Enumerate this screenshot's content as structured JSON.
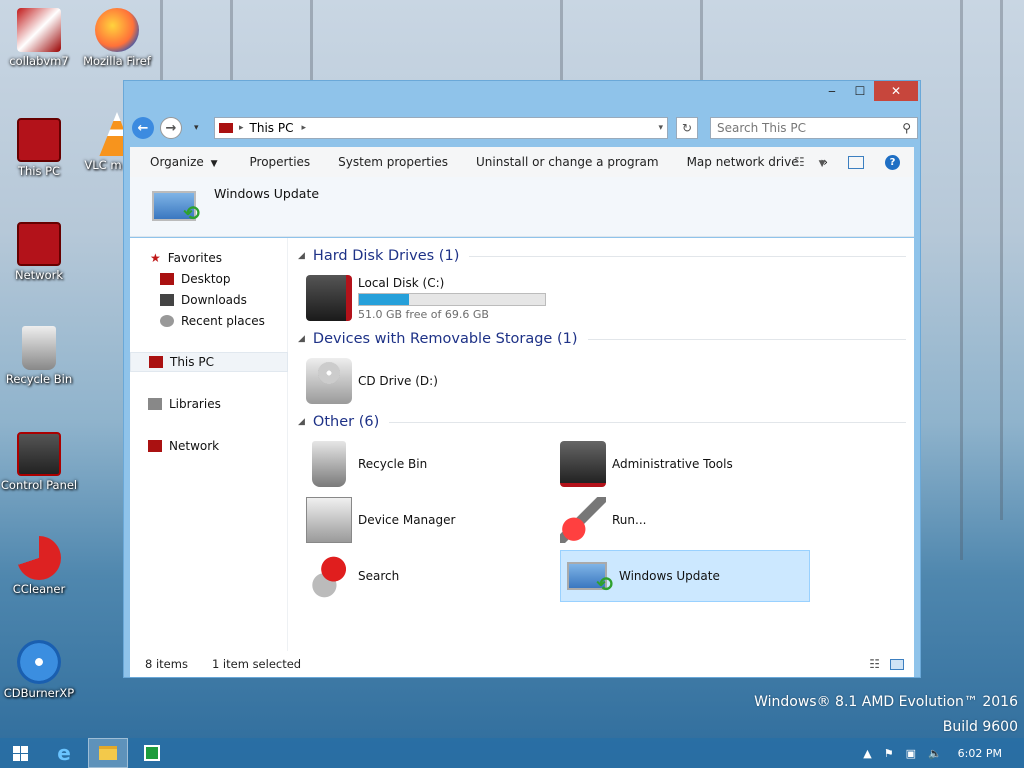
{
  "desktop": {
    "icons": [
      {
        "label": "collabvm7"
      },
      {
        "label": "Mozilla Firef"
      },
      {
        "label": "This PC"
      },
      {
        "label": "VLC m play"
      },
      {
        "label": "Network"
      },
      {
        "label": "Recycle Bin"
      },
      {
        "label": "Control Panel"
      },
      {
        "label": "CCleaner"
      },
      {
        "label": "CDBurnerXP"
      }
    ],
    "watermark_line1": "Windows® 8.1 AMD Evolution™ 2016",
    "watermark_line2": "Build 9600"
  },
  "window": {
    "controls": {
      "minimize": "‒",
      "maximize": "☐",
      "close": "✕"
    },
    "address": {
      "location": "This PC"
    },
    "search": {
      "placeholder": "Search This PC"
    },
    "toolbar": {
      "organize": "Organize",
      "properties": "Properties",
      "system_properties": "System properties",
      "uninstall": "Uninstall or change a program",
      "map_drive": "Map network drive",
      "more": "»"
    },
    "preview": {
      "title": "Windows Update"
    },
    "nav": {
      "favorites": "Favorites",
      "desktop": "Desktop",
      "downloads": "Downloads",
      "recent": "Recent places",
      "this_pc": "This PC",
      "libraries": "Libraries",
      "network": "Network"
    },
    "groups": {
      "hdd": "Hard Disk Drives (1)",
      "removable": "Devices with Removable Storage (1)",
      "other": "Other (6)"
    },
    "items": {
      "local_disk": {
        "name": "Local Disk (C:)",
        "free": "51.0 GB free of 69.6 GB",
        "used_fraction": 0.267
      },
      "cd_drive": "CD Drive (D:)",
      "recycle_bin": "Recycle Bin",
      "admin_tools": "Administrative Tools",
      "device_manager": "Device Manager",
      "run": "Run...",
      "search": "Search",
      "windows_update": "Windows Update"
    },
    "status": {
      "count": "8 items",
      "selected": "1 item selected"
    }
  },
  "taskbar": {
    "clock": "6:02 PM"
  },
  "colors": {
    "accent": "#1e3287",
    "selection": "#cce8ff",
    "disk_bar": "#26a0da",
    "close_button": "#c7463c"
  }
}
